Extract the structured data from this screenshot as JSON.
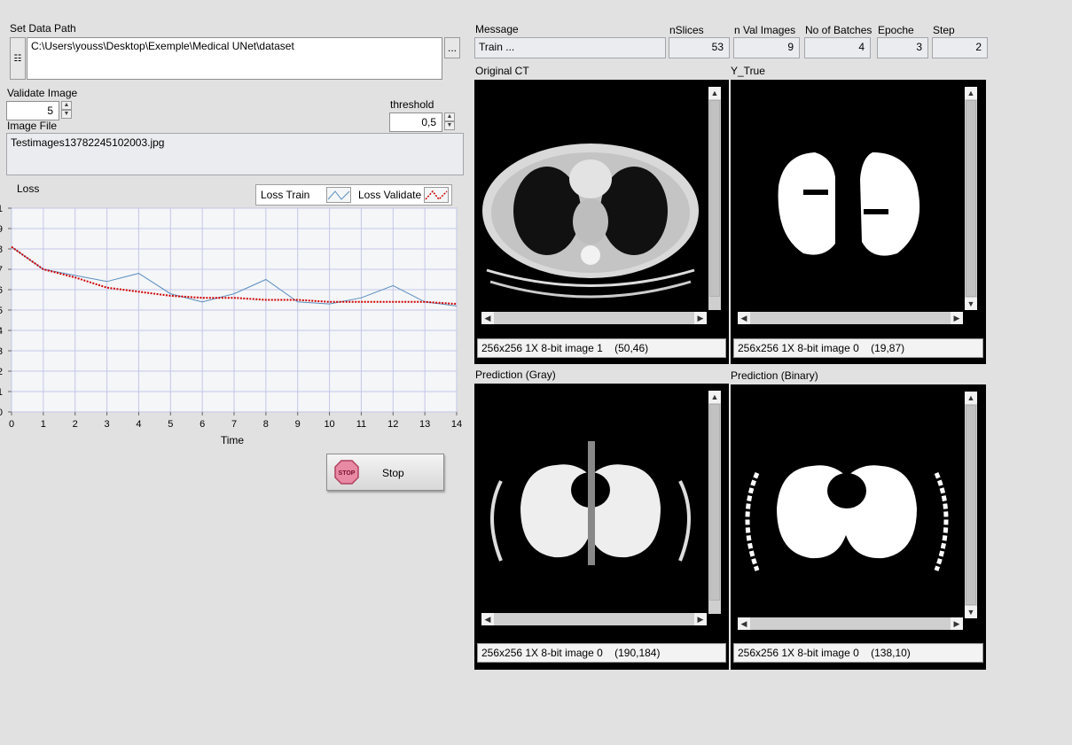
{
  "data_path": {
    "label": "Set Data Path",
    "value": "C:\\Users\\youss\\Desktop\\Exemple\\Medical UNet\\dataset",
    "browse_label": "..."
  },
  "validate_image": {
    "label": "Validate Image",
    "value": "5"
  },
  "threshold": {
    "label": "threshold",
    "value": "0,5"
  },
  "image_file": {
    "label": "Image File",
    "value": "Testimages13782245102003.jpg"
  },
  "loss_chart": {
    "title": "Loss",
    "xlabel": "Time",
    "legend": [
      {
        "name": "Loss Train",
        "color": "#5b8fbf"
      },
      {
        "name": "Loss Validate",
        "color": "#d00000"
      }
    ],
    "y_tick_labels": [
      "1",
      "9",
      "8",
      "7",
      "6",
      "5",
      "4",
      "3",
      "2",
      "1",
      "0"
    ],
    "x_tick_labels": [
      "0",
      "1",
      "2",
      "3",
      "4",
      "5",
      "6",
      "7",
      "8",
      "9",
      "10",
      "11",
      "12",
      "13",
      "14"
    ]
  },
  "chart_data": {
    "type": "line",
    "title": "Loss",
    "xlabel": "Time",
    "ylabel": "",
    "x": [
      0,
      1,
      2,
      3,
      4,
      5,
      6,
      7,
      8,
      9,
      10,
      11,
      12,
      13,
      14
    ],
    "xlim": [
      0,
      14
    ],
    "ylim": [
      0,
      1
    ],
    "grid": true,
    "legend_position": "top-right",
    "series": [
      {
        "name": "Loss Train",
        "values": [
          0.81,
          0.7,
          0.67,
          0.64,
          0.68,
          0.58,
          0.54,
          0.58,
          0.65,
          0.54,
          0.53,
          0.56,
          0.62,
          0.54,
          0.52
        ]
      },
      {
        "name": "Loss Validate",
        "values": [
          0.81,
          0.7,
          0.66,
          0.61,
          0.59,
          0.57,
          0.56,
          0.56,
          0.55,
          0.55,
          0.54,
          0.54,
          0.54,
          0.54,
          0.53
        ]
      }
    ]
  },
  "stop_button": {
    "label": "Stop",
    "icon_text": "STOP"
  },
  "header": {
    "message": {
      "label": "Message",
      "value": "Train ..."
    },
    "nslices": {
      "label": "nSlices",
      "value": "53"
    },
    "nval": {
      "label": "n Val Images",
      "value": "9"
    },
    "batches": {
      "label": "No of Batches",
      "value": "4"
    },
    "epoche": {
      "label": "Epoche",
      "value": "3"
    },
    "step": {
      "label": "Step",
      "value": "2"
    }
  },
  "panels": {
    "original": {
      "label": "Original CT",
      "info": "256x256 1X 8-bit image 1    (50,46)"
    },
    "ytrue": {
      "label": "Y_True",
      "info": "256x256 1X 8-bit image 0    (19,87)"
    },
    "pred_gray": {
      "label": "Prediction (Gray)",
      "info": "256x256 1X 8-bit image 0    (190,184)"
    },
    "pred_binary": {
      "label": "Prediction (Binary)",
      "info": "256x256 1X 8-bit image 0    (138,10)"
    }
  }
}
